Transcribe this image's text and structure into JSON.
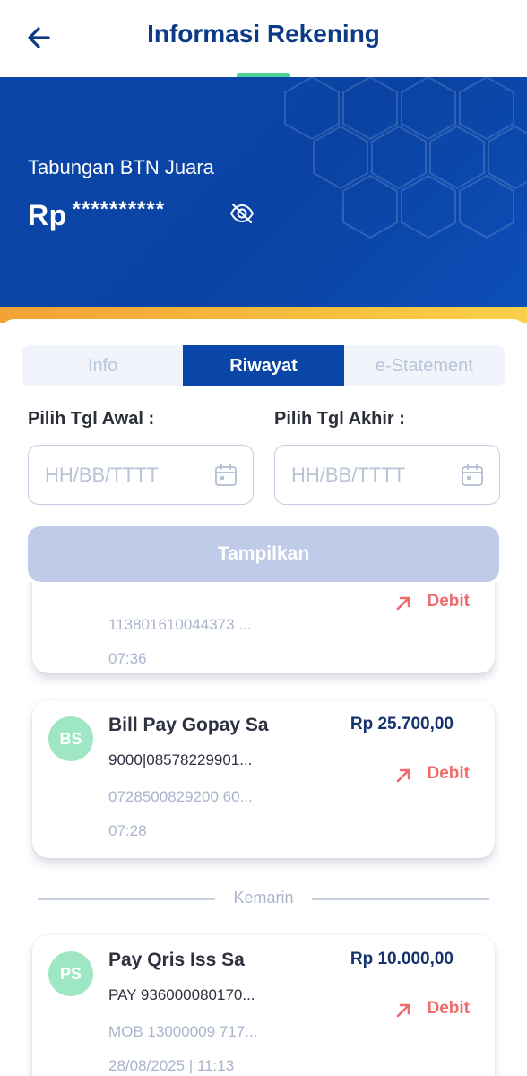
{
  "header": {
    "title": "Informasi Rekening"
  },
  "account": {
    "name": "Tabungan BTN Juara",
    "currency": "Rp",
    "balance_masked": "**********"
  },
  "tabs": [
    {
      "label": "Info"
    },
    {
      "label": "Riwayat"
    },
    {
      "label": "e-Statement"
    }
  ],
  "filter": {
    "start_label": "Pilih Tgl Awal :",
    "end_label": "Pilih Tgl Akhir :",
    "start_placeholder": "HH/BB/TTTT",
    "end_placeholder": "HH/BB/TTTT",
    "submit_label": "Tampilkan"
  },
  "transactions": [
    {
      "initials": "",
      "name": "",
      "amount": "",
      "desc": "",
      "ref": "113801610044373 ...",
      "time": "07:36",
      "type": "Debit"
    },
    {
      "initials": "BS",
      "name": "Bill Pay Gopay Sa",
      "amount": "Rp 25.700,00",
      "desc": "9000|08578229901...",
      "ref": "0728500829200 60...",
      "time": "07:28",
      "type": "Debit"
    },
    {
      "initials": "PS",
      "name": "Pay Qris Iss Sa",
      "amount": "Rp 10.000,00",
      "desc": "PAY 936000080170...",
      "ref": "MOB 13000009 717...",
      "time": "28/08/2025 | 11:13",
      "type": "Debit"
    }
  ],
  "section_divider": "Kemarin",
  "colors": {
    "primary": "#0a45a8",
    "title": "#0b3a86",
    "debit": "#ef6a6a",
    "accent_stripe": "#f7bf3e"
  }
}
